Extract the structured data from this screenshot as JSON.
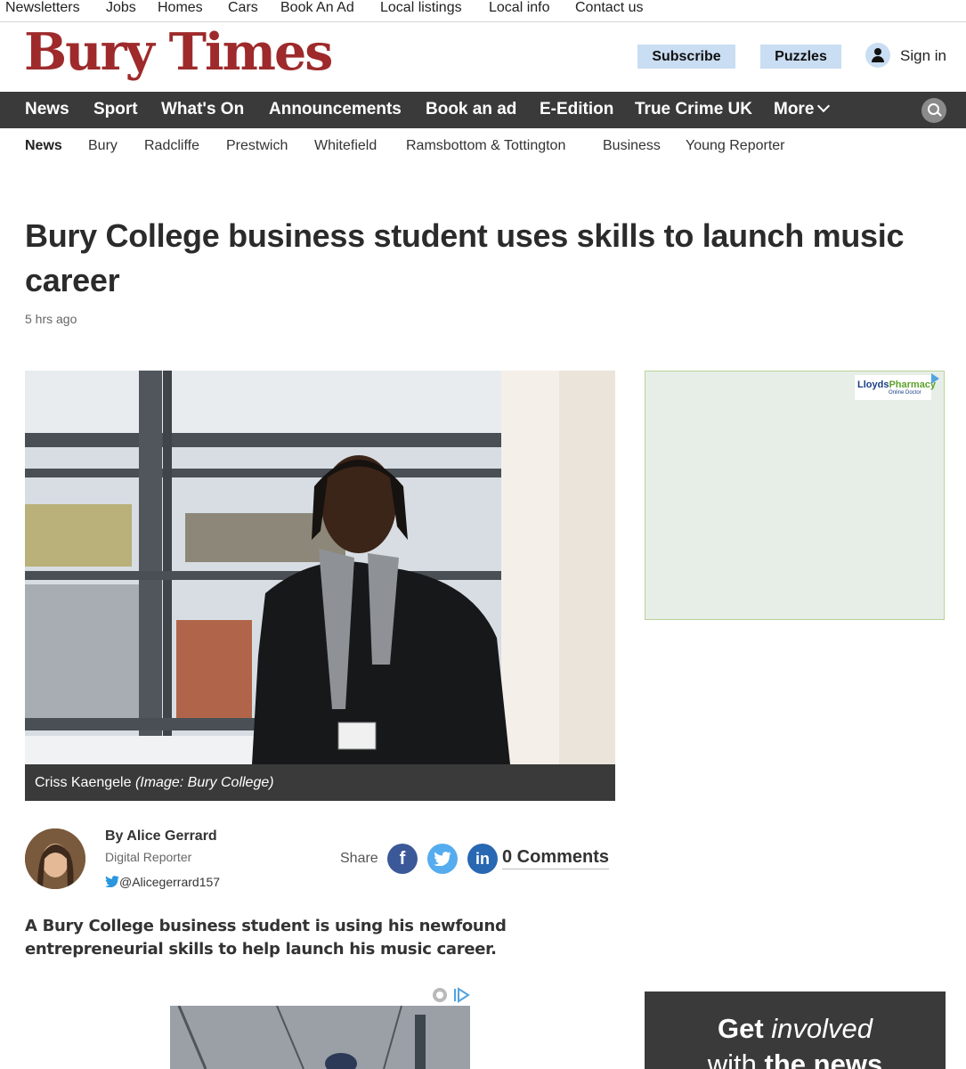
{
  "utility_nav": [
    "Newsletters",
    "Jobs",
    "Homes",
    "Cars",
    "Book An Ad",
    "Local listings",
    "Local info",
    "Contact us"
  ],
  "header": {
    "logo": "Bury Times",
    "subscribe_label": "Subscribe",
    "puzzles_label": "Puzzles",
    "signin_label": "Sign in"
  },
  "primary_nav": [
    "News",
    "Sport",
    "What's On",
    "Announcements",
    "Book an ad",
    "E-Edition",
    "True Crime UK",
    "More"
  ],
  "secondary_nav": [
    "News",
    "Bury",
    "Radcliffe",
    "Prestwich",
    "Whitefield",
    "Ramsbottom & Tottington",
    "Business",
    "Young Reporter"
  ],
  "article": {
    "headline": "Bury College business student uses skills to launch music career",
    "timestamp": "5 hrs ago",
    "caption_name": "Criss Kaengele",
    "caption_credit": "(Image: Bury College)",
    "author": "By Alice Gerrard",
    "author_role": "Digital Reporter",
    "author_twitter": "@Alicegerrard157",
    "share_label": "Share",
    "comments": "0 Comments",
    "lead": "A Bury College business student is using his newfound entrepreneurial skills to help launch his music career."
  },
  "ad": {
    "brand_main": "Lloyds",
    "brand_accent": "Pharmacy",
    "brand_sub": "Online Doctor"
  },
  "promo": {
    "line1_bold": "Get",
    "line1_italic": "involved",
    "line2_pre": "with",
    "line2_bold": "the news"
  },
  "colors": {
    "brand": "#9e2a2b",
    "nav_bg": "#3a3a3a",
    "pill_bg": "#c9ddf3",
    "facebook": "#3b5998",
    "twitter": "#55acee",
    "linkedin": "#2867b2"
  }
}
